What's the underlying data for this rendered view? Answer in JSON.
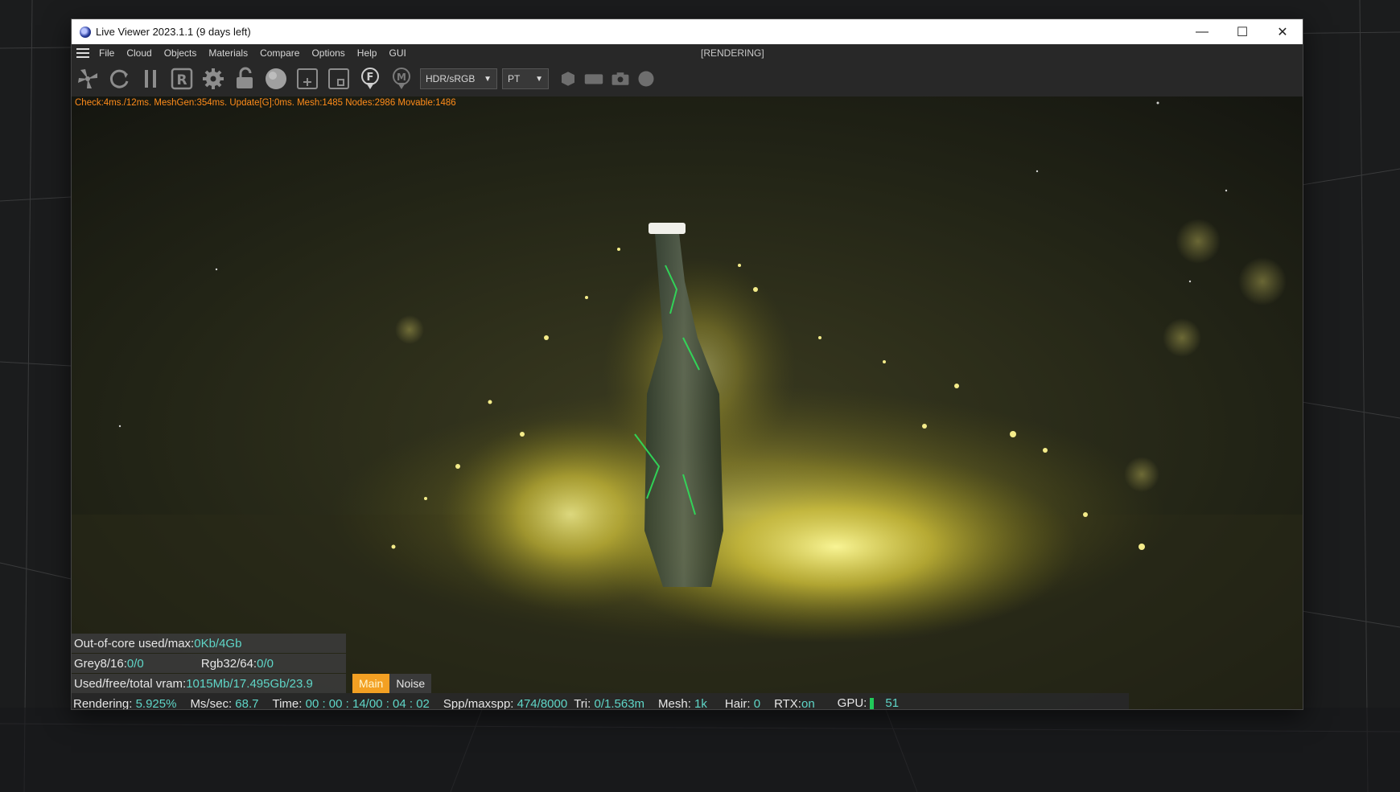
{
  "window": {
    "title": "Live Viewer 2023.1.1 (9 days left)",
    "controls": {
      "minimize": "—",
      "maximize": "☐",
      "close": "✕"
    }
  },
  "menu": {
    "items": [
      "File",
      "Cloud",
      "Objects",
      "Materials",
      "Compare",
      "Options",
      "Help",
      "GUI"
    ],
    "render_state": "[RENDERING]"
  },
  "toolbar": {
    "icons": [
      "settings-fan-icon",
      "refresh-icon",
      "pause-icon",
      "r-box-icon",
      "gear-icon",
      "unlock-icon",
      "sphere-icon",
      "add-region-icon",
      "region-icon",
      "focus-pin-icon",
      "material-pin-icon"
    ],
    "color_space": {
      "selected": "HDR/sRGB"
    },
    "kernel": {
      "selected": "PT"
    },
    "extra_icons": [
      "hexagon-icon",
      "rectangle-icon",
      "camera-icon",
      "circle-icon"
    ]
  },
  "viewport": {
    "stats": "Check:4ms./12ms. MeshGen:354ms. Update[G]:0ms. Mesh:1485 Nodes:2986 Movable:1486"
  },
  "memory": {
    "out_of_core_label": "Out-of-core used/max:",
    "out_of_core_value": "0Kb/4Gb",
    "grey_label": "Grey8/16: ",
    "grey_value": "0/0",
    "rgb_label": "Rgb32/64: ",
    "rgb_value": "0/0",
    "vram_label": "Used/free/total vram: ",
    "vram_value": "1015Mb/17.495Gb/23.9"
  },
  "tabs": {
    "main": "Main",
    "noise": "Noise"
  },
  "status": {
    "rendering_label": "Rendering: ",
    "rendering_value": "5.925%",
    "mssec_label": "Ms/sec: ",
    "mssec_value": "68.7",
    "time_label": "Time: ",
    "time_value": "00 : 00 : 14/00 : 04 : 02",
    "spp_label": "Spp/maxspp: ",
    "spp_value": "474/8000",
    "tri_label": "Tri: ",
    "tri_value": "0/1.563m",
    "mesh_label": "Mesh: ",
    "mesh_value": "1k",
    "hair_label": "Hair: ",
    "hair_value": "0",
    "rtx_label": "RTX:",
    "rtx_value": "on",
    "gpu_label": "GPU:",
    "gpu_value": "51",
    "progress_fraction": 0.05925
  },
  "colors": {
    "accent_orange": "#ff8c1a",
    "value_teal": "#5fd6c8",
    "progress_green": "#22c655",
    "tab_orange": "#f3a023"
  }
}
